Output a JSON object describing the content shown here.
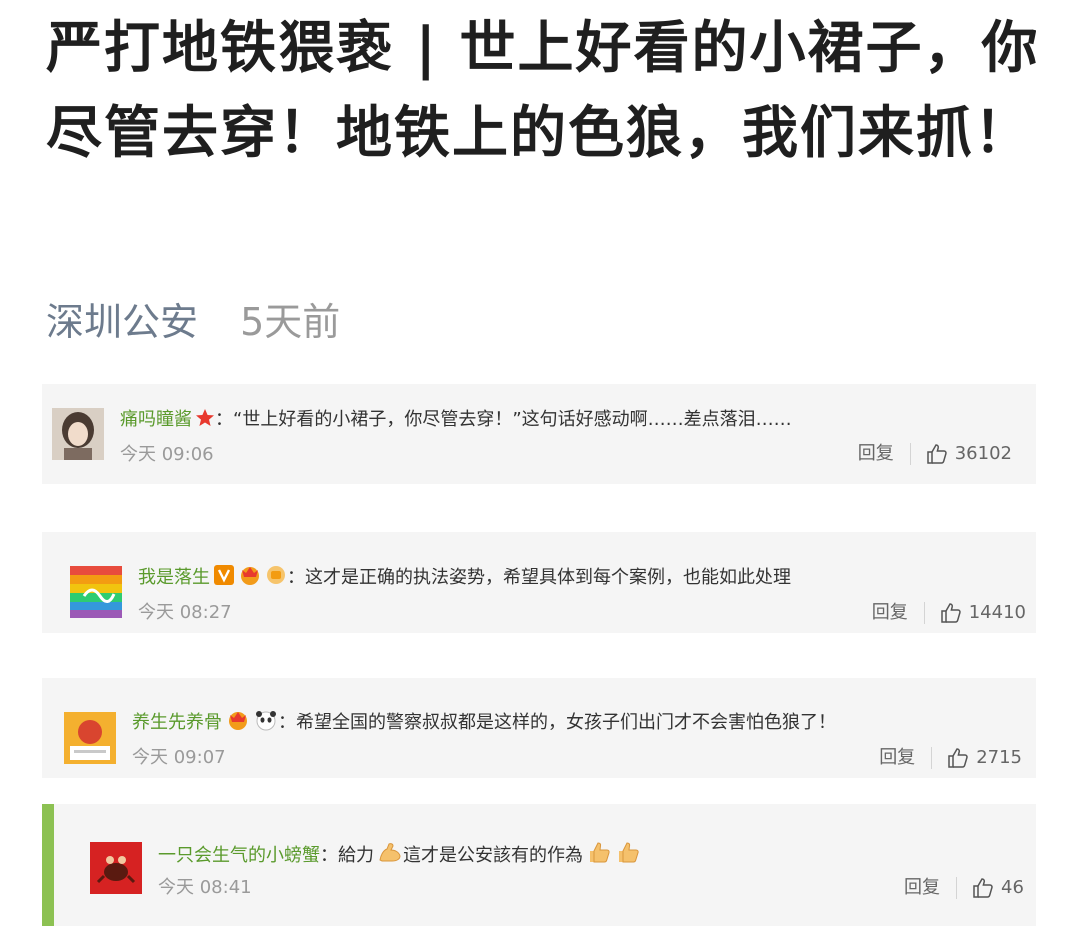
{
  "article": {
    "title": "严打地铁猥亵 | 世上好看的小裙子，你尽管去穿！地铁上的色狼，我们来抓！",
    "author": "深圳公安",
    "time": "5天前"
  },
  "comments": [
    {
      "user": "痛吗瞳酱",
      "text": "：“世上好看的小裙子，你尽管去穿！”这句话好感动啊……差点落泪……",
      "time": "今天 09:06",
      "reply_label": "回复",
      "likes": "36102"
    },
    {
      "user": "我是落生",
      "text": "：这才是正确的执法姿势，希望具体到每个案例，也能如此处理",
      "time": "今天 08:27",
      "reply_label": "回复",
      "likes": "14410"
    },
    {
      "user": "养生先养骨",
      "text": "：希望全国的警察叔叔都是这样的，女孩子们出门才不会害怕色狼了！",
      "time": "今天 09:07",
      "reply_label": "回复",
      "likes": "2715"
    },
    {
      "user": "一只会生气的小螃蟹",
      "text_a": "：給力",
      "text_b": "這才是公安該有的作為",
      "time": "今天 08:41",
      "reply_label": "回复",
      "likes": "46"
    }
  ],
  "colors": {
    "username": "#5a9a2c",
    "author": "#6d7b8d",
    "reply_accent": "#8cc152"
  }
}
